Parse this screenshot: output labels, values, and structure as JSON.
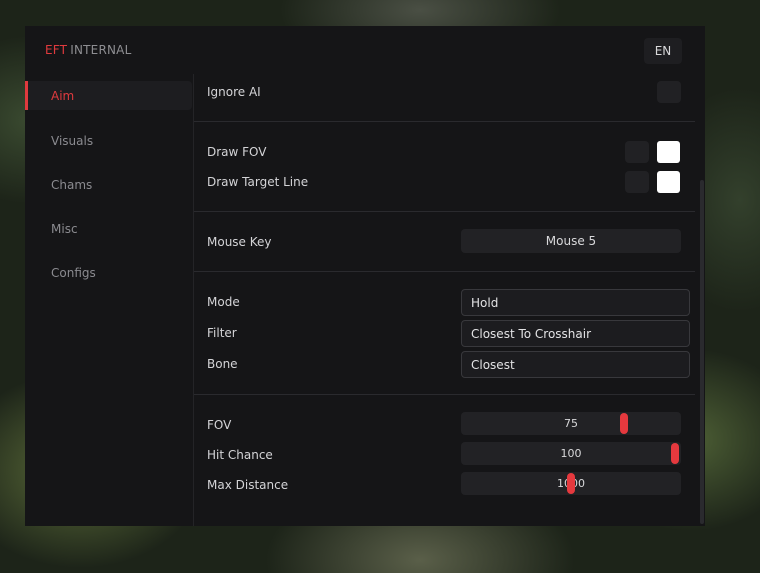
{
  "app": {
    "brand_red": "EFT",
    "brand_rest": "INTERNAL",
    "language": "EN",
    "accent": "#e03a3e"
  },
  "sidebar": {
    "items": [
      {
        "label": "Aim",
        "active": true
      },
      {
        "label": "Visuals",
        "active": false
      },
      {
        "label": "Chams",
        "active": false
      },
      {
        "label": "Misc",
        "active": false
      },
      {
        "label": "Configs",
        "active": false
      }
    ]
  },
  "aim": {
    "ignore_ai": {
      "label": "Ignore AI",
      "checked": false
    },
    "draw_fov": {
      "label": "Draw FOV",
      "checked": false,
      "color": "#ffffff"
    },
    "draw_target_line": {
      "label": "Draw Target Line",
      "checked": false,
      "color": "#ffffff"
    },
    "mouse_key": {
      "label": "Mouse Key",
      "value": "Mouse 5"
    },
    "mode": {
      "label": "Mode",
      "value": "Hold"
    },
    "filter": {
      "label": "Filter",
      "value": "Closest To Crosshair"
    },
    "bone": {
      "label": "Bone",
      "value": "Closest"
    },
    "fov": {
      "label": "FOV",
      "value": "75",
      "fraction": 0.75
    },
    "hit_chance": {
      "label": "Hit Chance",
      "value": "100",
      "fraction": 1.0
    },
    "max_distance": {
      "label": "Max Distance",
      "value": "1000",
      "fraction": 0.5
    }
  }
}
